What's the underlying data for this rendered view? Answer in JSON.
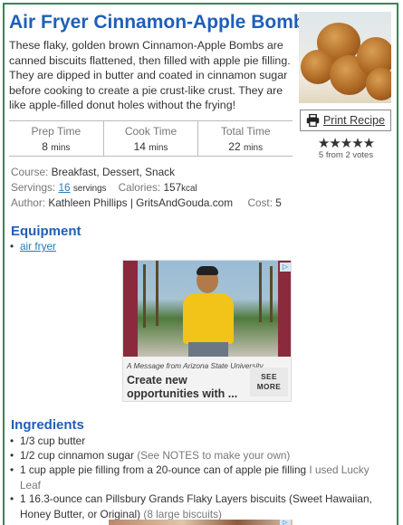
{
  "recipe": {
    "title": "Air Fryer Cinnamon-Apple Bombs",
    "summary": "These flaky, golden brown Cinnamon-Apple Bombs are canned biscuits flattened, then filled with apple pie filling. They are dipped in butter and coated in cinnamon sugar before cooking to create a pie crust-like crust. They are like apple-filled donut holes without the frying!",
    "print_label": "Print Recipe",
    "rating": {
      "stars": "★★★★★",
      "votes_text": "5 from 2 votes",
      "value": 5,
      "max": 5
    },
    "times": [
      {
        "label": "Prep Time",
        "value": "8",
        "unit": "mins"
      },
      {
        "label": "Cook Time",
        "value": "14",
        "unit": "mins"
      },
      {
        "label": "Total Time",
        "value": "22",
        "unit": "mins"
      }
    ],
    "course_label": "Course:",
    "course_value": "Breakfast, Dessert, Snack",
    "servings_label": "Servings:",
    "servings_value": "16",
    "servings_unit": "servings",
    "calories_label": "Calories:",
    "calories_value": "157",
    "calories_unit": "kcal",
    "author_label": "Author:",
    "author_value": "Kathleen Phillips | GritsAndGouda.com",
    "cost_label": "Cost:",
    "cost_value": "5"
  },
  "equipment": {
    "heading": "Equipment",
    "items": [
      "air fryer"
    ]
  },
  "ad": {
    "from_text": "A Message from Arizona State University",
    "headline": "Create new opportunities with ...",
    "cta": "SEE MORE",
    "badge": "▷"
  },
  "ingredients": {
    "heading": "Ingredients",
    "items": [
      {
        "main": "1/3 cup butter",
        "note": ""
      },
      {
        "main": "1/2 cup cinnamon sugar",
        "note": "(See NOTES to make your own)"
      },
      {
        "main": "1 cup apple pie filling from a 20-ounce can of apple pie filling",
        "note": "I used Lucky Leaf"
      },
      {
        "main": "1 16.3-ounce can Pillsbury Grands Flaky Layers biscuits (Sweet Hawaiian, Honey Butter, or Original)",
        "note": "(8 large biscuits)"
      }
    ]
  },
  "icons": {
    "print": "printer-icon",
    "stars": "star-rating-icon",
    "ad_choices": "ad-choices-icon"
  }
}
